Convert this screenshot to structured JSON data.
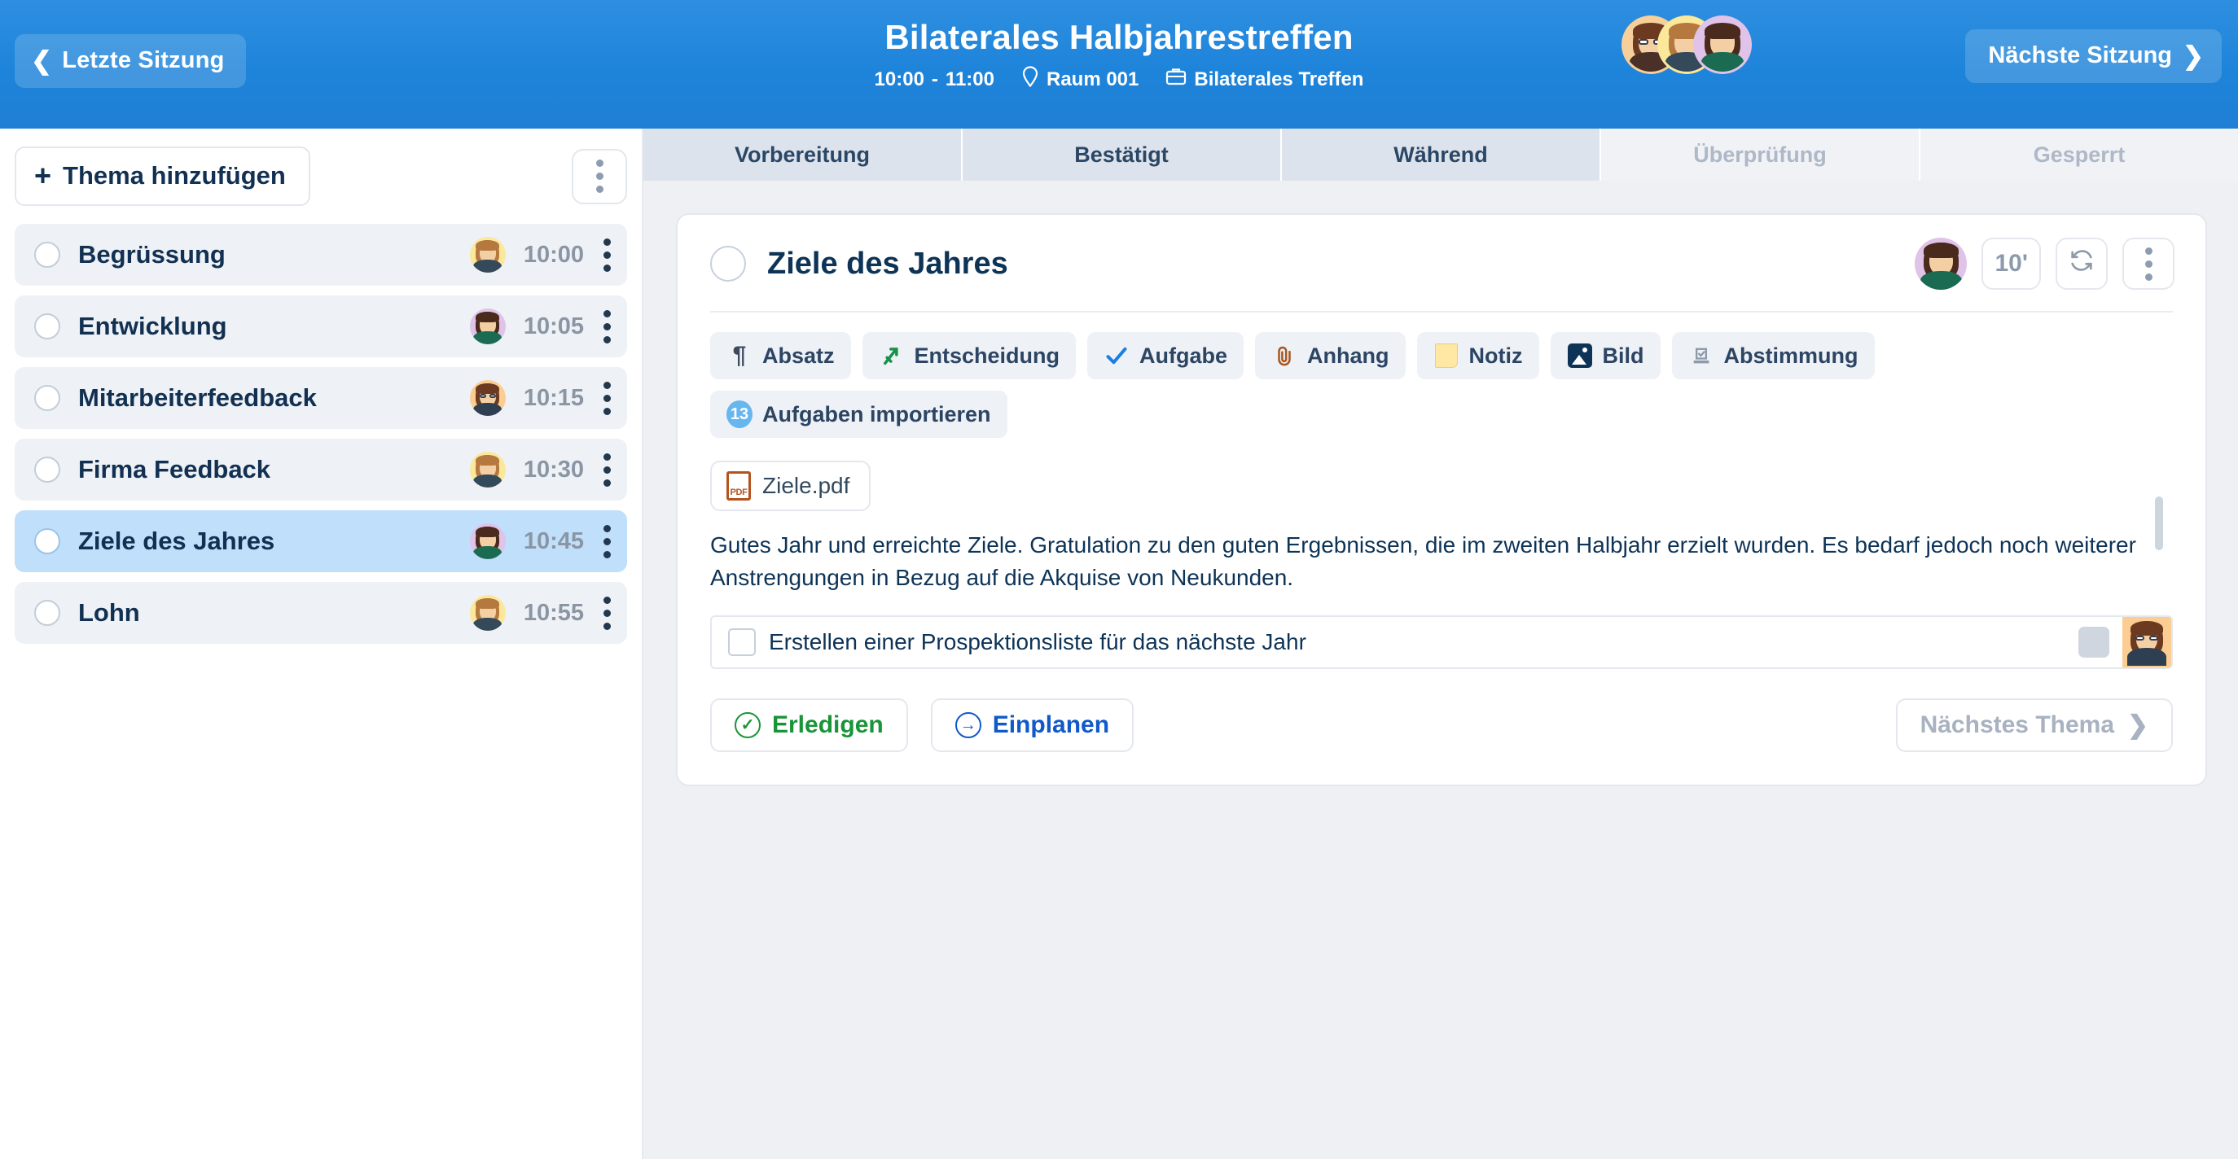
{
  "header": {
    "prev_session_label": "Letzte Sitzung",
    "next_session_label": "Nächste Sitzung",
    "title": "Bilaterales Halbjahrestreffen",
    "time_start": "10:00",
    "time_dash": "-",
    "time_end": "11:00",
    "location_icon": "location-pin-icon",
    "location": "Raum 001",
    "type_icon": "briefcase-icon",
    "meeting_type": "Bilaterales Treffen",
    "participants": [
      {
        "name": "participant-1",
        "bg": "#f6cf9a",
        "hair": "#6b3a20",
        "body": "#4a3027",
        "glasses": true
      },
      {
        "name": "participant-2",
        "bg": "#fbe89a",
        "hair": "#b5793f",
        "body": "#34495a",
        "glasses": false
      },
      {
        "name": "participant-3",
        "bg": "#e0c3e8",
        "hair": "#4a2a1c",
        "body": "#1b6b53",
        "glasses": false
      }
    ]
  },
  "sidebar": {
    "add_topic_label": "Thema hinzufügen",
    "add_topic_plus": "+",
    "more_menu_icon": "kebab-menu-icon",
    "topics": [
      {
        "name": "Begrüssung",
        "time": "10:00",
        "selected": false,
        "avatar": {
          "bg": "#fbe89a",
          "hair": "#b5793f",
          "body": "#34495a",
          "glasses": false
        }
      },
      {
        "name": "Entwicklung",
        "time": "10:05",
        "selected": false,
        "avatar": {
          "bg": "#e0c3e8",
          "hair": "#4a2a1c",
          "body": "#1b6b53",
          "glasses": false
        }
      },
      {
        "name": "Mitarbeiterfeedback",
        "time": "10:15",
        "selected": false,
        "avatar": {
          "bg": "#fbcd93",
          "hair": "#6b3a20",
          "body": "#2f3f52",
          "glasses": true
        }
      },
      {
        "name": "Firma Feedback",
        "time": "10:30",
        "selected": false,
        "avatar": {
          "bg": "#fbe89a",
          "hair": "#b5793f",
          "body": "#34495a",
          "glasses": false
        }
      },
      {
        "name": "Ziele des Jahres",
        "time": "10:45",
        "selected": true,
        "avatar": {
          "bg": "#e0c3e8",
          "hair": "#4a2a1c",
          "body": "#1b6b53",
          "glasses": false
        }
      },
      {
        "name": "Lohn",
        "time": "10:55",
        "selected": false,
        "avatar": {
          "bg": "#fbe89a",
          "hair": "#b5793f",
          "body": "#34495a",
          "glasses": false
        }
      }
    ]
  },
  "tabs": [
    {
      "label": "Vorbereitung",
      "state": "active"
    },
    {
      "label": "Bestätigt",
      "state": "active"
    },
    {
      "label": "Während",
      "state": "active"
    },
    {
      "label": "Überprüfung",
      "state": "disabled"
    },
    {
      "label": "Gesperrt",
      "state": "disabled"
    }
  ],
  "topic_card": {
    "title": "Ziele des Jahres",
    "duration": "10'",
    "refresh_icon": "refresh-icon",
    "more_icon": "kebab-menu-icon",
    "owner_avatar": {
      "bg": "#e0c3e8",
      "hair": "#4a2a1c",
      "body": "#1b6b53",
      "glasses": false
    },
    "toolbar": [
      {
        "label": "Absatz",
        "icon": "pilcrow-icon"
      },
      {
        "label": "Entscheidung",
        "icon": "decision-arrow-icon"
      },
      {
        "label": "Aufgabe",
        "icon": "checkmark-icon"
      },
      {
        "label": "Anhang",
        "icon": "paperclip-icon"
      },
      {
        "label": "Notiz",
        "icon": "sticky-note-icon"
      },
      {
        "label": "Bild",
        "icon": "image-icon"
      },
      {
        "label": "Abstimmung",
        "icon": "vote-icon"
      },
      {
        "label": "Aufgaben importieren",
        "icon": "badge-count-icon",
        "badge": "13"
      }
    ],
    "attachment": {
      "file_name": "Ziele.pdf",
      "icon": "pdf-file-icon",
      "icon_label": "PDF"
    },
    "paragraph": "Gutes Jahr und erreichte Ziele. Gratulation zu den guten Ergebnissen, die im zweiten Halbjahr erzielt wurden. Es bedarf jedoch noch weiterer Anstrengungen in Bezug auf die Akquise von Neukunden.",
    "task": {
      "label": "Erstellen einer Prospektionsliste für das nächste Jahr",
      "checked": false,
      "assignee_avatar": {
        "bg": "#fbcd93",
        "hair": "#6b3a20",
        "body": "#2f3f52",
        "glasses": true
      }
    },
    "footer": {
      "done_label": "Erledigen",
      "done_icon": "check-circle-icon",
      "schedule_label": "Einplanen",
      "schedule_icon": "arrow-circle-right-icon",
      "next_topic_label": "Nächstes Thema"
    }
  },
  "colors": {
    "brand_blue": "#1e84da",
    "selected_row": "#bfdffb",
    "title_navy": "#0d3356",
    "green": "#1a9438",
    "link_blue": "#1059c9",
    "muted": "#a8b2c0"
  }
}
